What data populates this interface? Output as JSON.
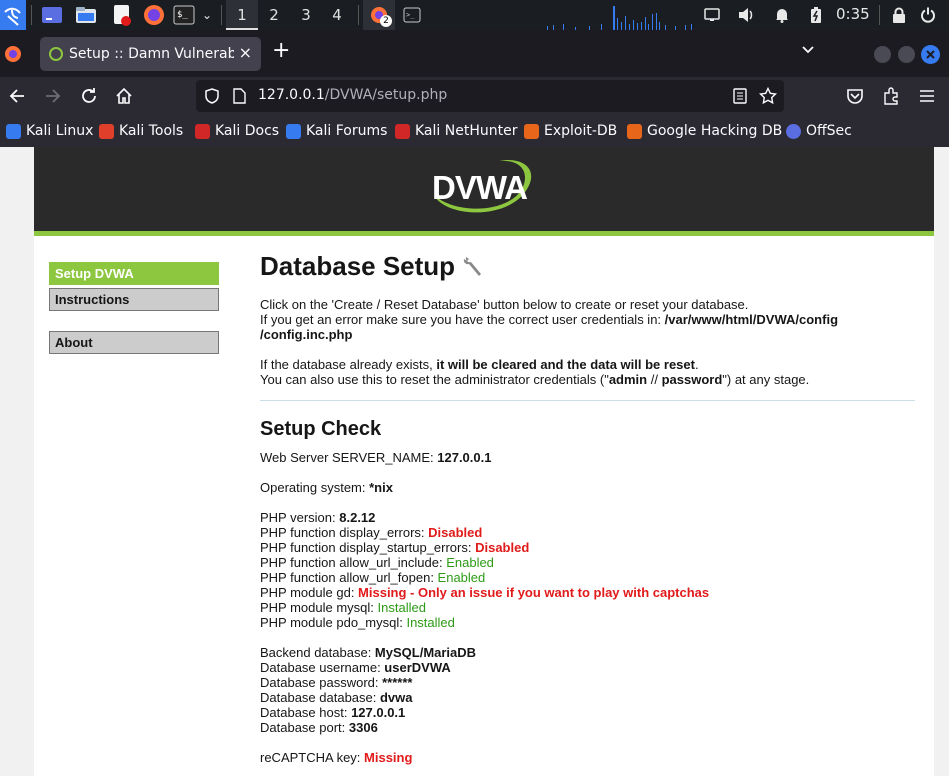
{
  "taskbar": {
    "workspaces": [
      "1",
      "2",
      "3",
      "4"
    ],
    "firefox_badge": "2",
    "clock": "0:35"
  },
  "browser": {
    "tab_title": "Setup :: Damn Vulnerable",
    "tab_close": "×",
    "new_tab": "+",
    "url_host": "127.0.0.1",
    "url_path": "/DVWA/setup.php",
    "bookmarks": [
      {
        "label": "Kali Linux",
        "color": "#367bf0"
      },
      {
        "label": "Kali Tools",
        "color": "#e0402b"
      },
      {
        "label": "Kali Docs",
        "color": "#d12727"
      },
      {
        "label": "Kali Forums",
        "color": "#367bf0"
      },
      {
        "label": "Kali NetHunter",
        "color": "#d12727"
      },
      {
        "label": "Exploit-DB",
        "color": "#e8661a"
      },
      {
        "label": "Google Hacking DB",
        "color": "#e8661a"
      },
      {
        "label": "OffSec",
        "color": "#5b6ee1"
      }
    ]
  },
  "colors": {
    "dvwa_green": "#8dc73f",
    "error_red": "#e11a1a",
    "ok_green": "#2d9b16"
  },
  "sidebar": {
    "items": [
      "Setup DVWA",
      "Instructions",
      "About"
    ],
    "selected": "Setup DVWA"
  },
  "main": {
    "title": "Database Setup",
    "intro1": "Click on the 'Create / Reset Database' button below to create or reset your database.",
    "intro2_prefix": "If you get an error make sure you have the correct user credentials in: ",
    "intro2_path_a": "/var/www/html/DVWA/config",
    "intro2_path_b": "/config.inc.php",
    "intro3_prefix": "If the database already exists, ",
    "intro3_bold": "it will be cleared and the data will be reset",
    "intro3_suffix": ".",
    "intro4_prefix": "You can also use this to reset the administrator credentials (\"",
    "intro4_user": "admin",
    "intro4_sep": " // ",
    "intro4_pass": "password",
    "intro4_suffix": "\") at any stage.",
    "check_title": "Setup Check",
    "server_name_label": "Web Server SERVER_NAME: ",
    "server_name": "127.0.0.1",
    "os_label": "Operating system: ",
    "os": "*nix",
    "php_version_label": "PHP version: ",
    "php_version": "8.2.12",
    "display_errors_label": "PHP function display_errors: ",
    "display_errors": "Disabled",
    "display_startup_errors_label": "PHP function display_startup_errors: ",
    "display_startup_errors": "Disabled",
    "allow_url_include_label": "PHP function allow_url_include: ",
    "allow_url_include": "Enabled",
    "allow_url_fopen_label": "PHP function allow_url_fopen: ",
    "allow_url_fopen": "Enabled",
    "gd_label": "PHP module gd: ",
    "gd": "Missing - Only an issue if you want to play with captchas",
    "mysql_label": "PHP module mysql: ",
    "mysql": "Installed",
    "pdo_mysql_label": "PHP module pdo_mysql: ",
    "pdo_mysql": "Installed",
    "backend_label": "Backend database: ",
    "backend": "MySQL/MariaDB",
    "db_user_label": "Database username: ",
    "db_user": "userDVWA",
    "db_pass_label": "Database password: ",
    "db_pass": "******",
    "db_name_label": "Database database: ",
    "db_name": "dvwa",
    "db_host_label": "Database host: ",
    "db_host": "127.0.0.1",
    "db_port_label": "Database port: ",
    "db_port": "3306",
    "recaptcha_label": "reCAPTCHA key: ",
    "recaptcha": "Missing"
  }
}
